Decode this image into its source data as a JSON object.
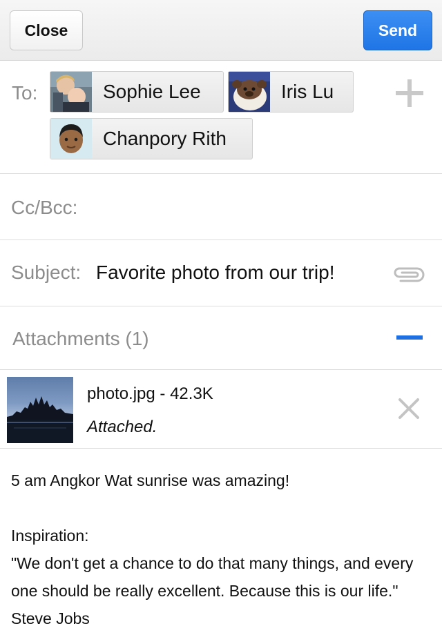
{
  "toolbar": {
    "close_label": "Close",
    "send_label": "Send"
  },
  "to": {
    "label": "To:",
    "recipients": [
      {
        "name": "Sophie Lee",
        "avatar": "photo-two-children"
      },
      {
        "name": "Iris Lu",
        "avatar": "photo-plush-toy"
      },
      {
        "name": "Chanpory Rith",
        "avatar": "cartoon-face"
      }
    ],
    "add_icon": "plus-icon"
  },
  "cc": {
    "label": "Cc/Bcc:"
  },
  "subject": {
    "label": "Subject:",
    "value": "Favorite photo from our trip!",
    "attach_icon": "paperclip-icon"
  },
  "attachments": {
    "header": "Attachments (1)",
    "collapse_icon": "minus-icon",
    "items": [
      {
        "file": "photo.jpg - 42.3K",
        "status": "Attached.",
        "remove_icon": "close-icon"
      }
    ]
  },
  "body": {
    "text": "5 am Angkor Wat sunrise was amazing!\n\nInspiration:\n\"We don't get a chance to do that many things, and every one should be really excellent. Because this is our life.\" Steve Jobs"
  },
  "colors": {
    "accent": "#1f75e6",
    "label_gray": "#8c8c8c"
  }
}
